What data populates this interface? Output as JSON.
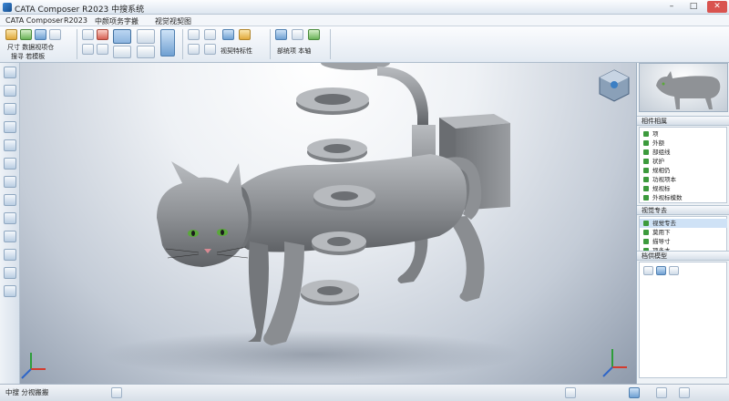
{
  "window": {
    "title": "CATA Composer    R2023  中搜系统"
  },
  "menu": {
    "items": [
      "CATA Composer",
      "R2023",
      "中颜项务字搬",
      "视觉视契图"
    ]
  },
  "ribbon": {
    "group1_line1": "尺寸 数据视项仓",
    "group1_line2": "搜寻  若模板",
    "group2_label": "视契特标性",
    "group3_label": "部统项 本轴"
  },
  "panel": {
    "section1_title": "相件相属",
    "section1_items": [
      "项",
      "外额",
      "部组线",
      "状护",
      "规相仍",
      "功视项本",
      "规视标",
      "外视标模数"
    ],
    "section2_title": "视觉专去",
    "section2_items": [
      "视觉专去",
      "莫用下",
      "描导寸",
      "项多本"
    ],
    "section3_title": "档供模型"
  },
  "status": {
    "left_text": "中搜   分视搬搬",
    "right_text": ""
  },
  "colors": {
    "accent": "#3c7fc4",
    "viewport_bg": "#c4ccd7",
    "model_gray": "#8a8d91"
  },
  "icons": [
    "app-logo-icon",
    "save-icon",
    "open-icon",
    "select-icon",
    "rotate-icon",
    "zoom-icon",
    "compass-icon",
    "axis-triad-icon"
  ]
}
